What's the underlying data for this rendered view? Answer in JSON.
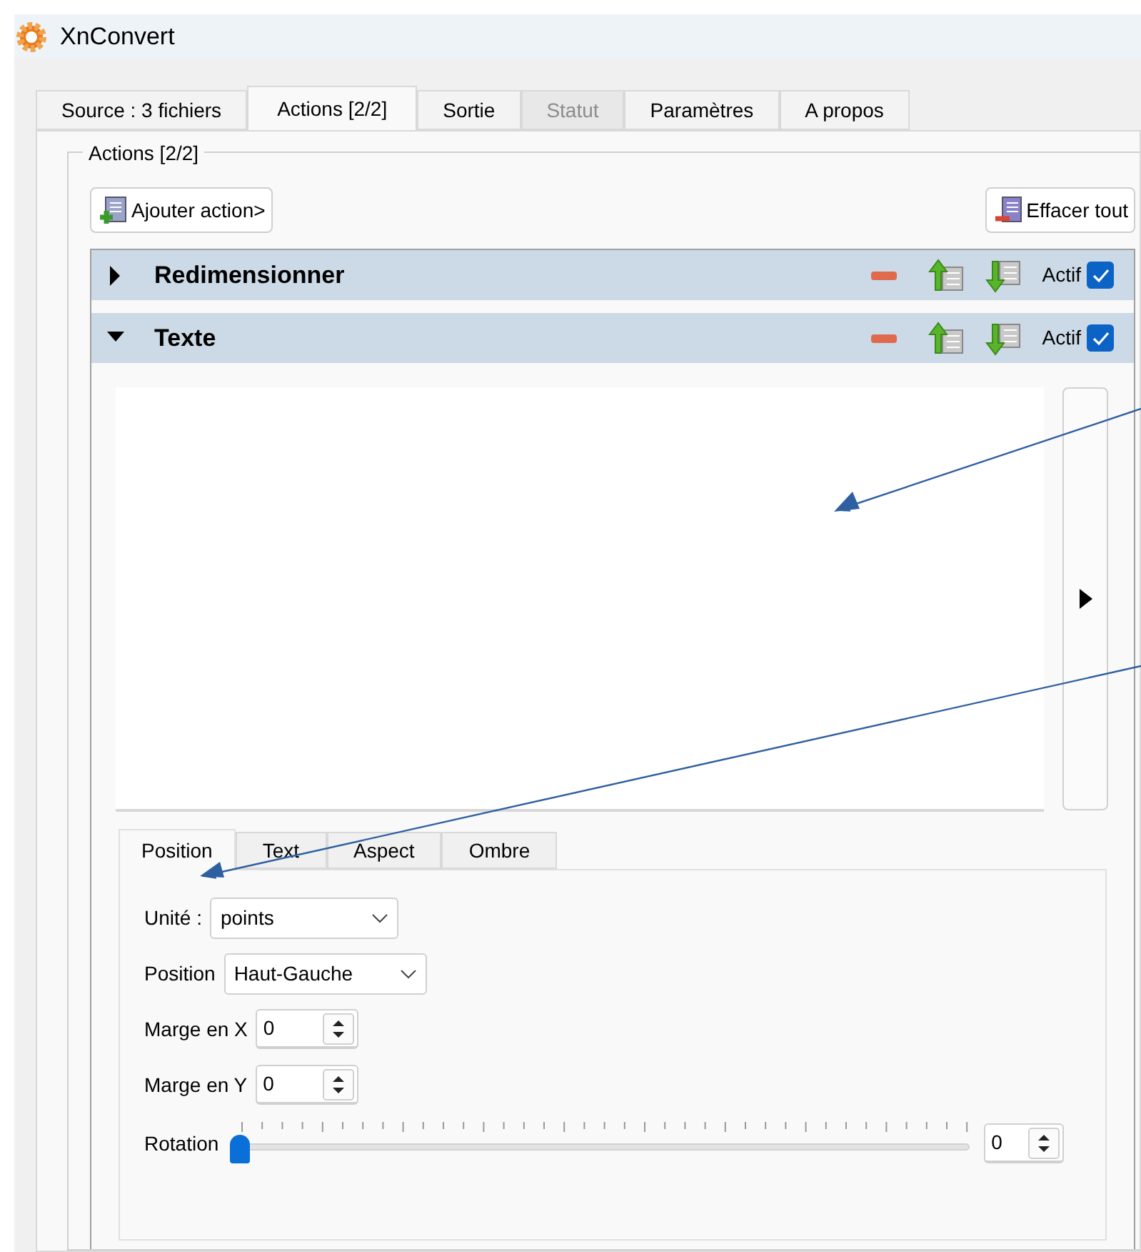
{
  "window": {
    "title": "XnConvert"
  },
  "tabs": [
    {
      "label": "Source : 3 fichiers",
      "selected": false,
      "disabled": false
    },
    {
      "label": "Actions [2/2]",
      "selected": true,
      "disabled": false
    },
    {
      "label": "Sortie",
      "selected": false,
      "disabled": false
    },
    {
      "label": "Statut",
      "selected": false,
      "disabled": true
    },
    {
      "label": "Paramètres",
      "selected": false,
      "disabled": false
    },
    {
      "label": "A propos",
      "selected": false,
      "disabled": false
    }
  ],
  "group": {
    "title": "Actions [2/2]"
  },
  "toolbar": {
    "add_button": "Ajouter action>",
    "clear_button": "Effacer tout"
  },
  "actions": [
    {
      "name": "Redimensionner",
      "expanded": false,
      "active_label": "Actif",
      "checked": true
    },
    {
      "name": "Texte",
      "expanded": true,
      "active_label": "Actif",
      "checked": true
    }
  ],
  "sub_tabs": [
    {
      "label": "Position",
      "selected": true
    },
    {
      "label": "Text",
      "selected": false
    },
    {
      "label": "Aspect",
      "selected": false
    },
    {
      "label": "Ombre",
      "selected": false
    }
  ],
  "form": {
    "unit": {
      "label": "Unité :",
      "value": "points"
    },
    "position": {
      "label": "Position",
      "value": "Haut-Gauche"
    },
    "margin_x": {
      "label": "Marge en X",
      "value": "0"
    },
    "margin_y": {
      "label": "Marge en Y",
      "value": "0"
    },
    "rotation": {
      "label": "Rotation",
      "level": 0,
      "value": "0"
    }
  }
}
